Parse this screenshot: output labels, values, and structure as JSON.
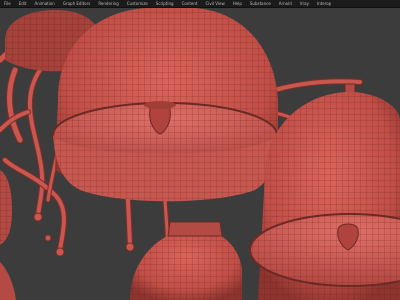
{
  "menubar": {
    "items": [
      {
        "label": "File"
      },
      {
        "label": "Edit"
      },
      {
        "label": "Animation"
      },
      {
        "label": "Graph Editors"
      },
      {
        "label": "Rendering"
      },
      {
        "label": "Customize"
      },
      {
        "label": "Scripting"
      },
      {
        "label": "Content"
      },
      {
        "label": "Civil View"
      },
      {
        "label": "Help"
      },
      {
        "label": "Substance"
      },
      {
        "label": "Arnold"
      },
      {
        "label": "Vray"
      },
      {
        "label": "Interop"
      }
    ]
  },
  "viewport": {
    "background_color": "#3c3c3c",
    "mesh_color": "#c9574f",
    "wire_color": "#5a1d19",
    "rim_color": "#6b2a25"
  }
}
